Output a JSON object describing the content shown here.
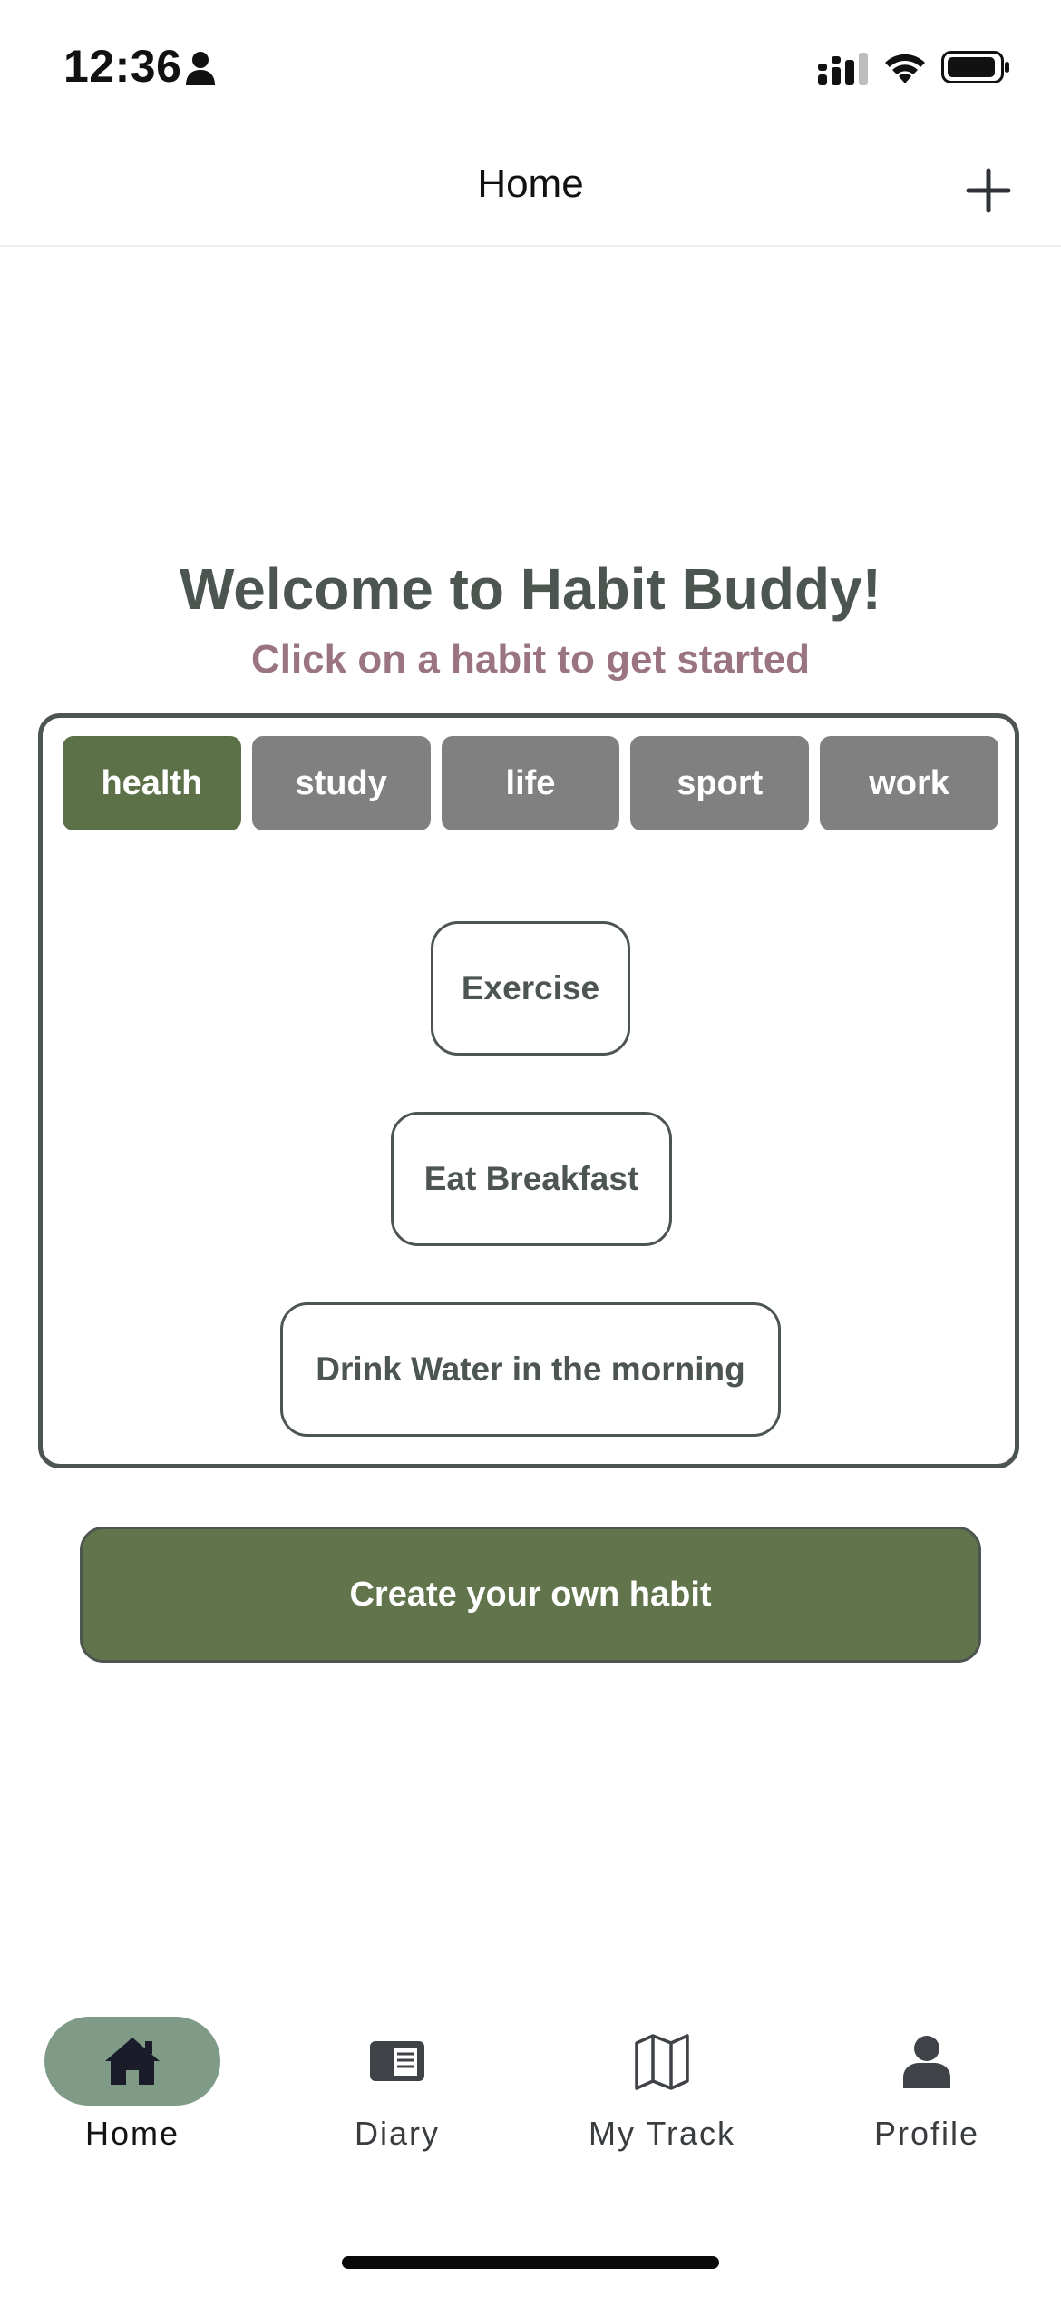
{
  "status_bar": {
    "time": "12:36"
  },
  "nav": {
    "title": "Home",
    "add_icon": "plus-icon"
  },
  "welcome": {
    "title": "Welcome to Habit Buddy!",
    "subtitle": "Click on a habit to get started"
  },
  "categories": {
    "selected": "health",
    "tabs": [
      {
        "label": "health"
      },
      {
        "label": "study"
      },
      {
        "label": "life"
      },
      {
        "label": "sport"
      },
      {
        "label": "work"
      }
    ]
  },
  "habits": [
    {
      "label": "Exercise"
    },
    {
      "label": "Eat Breakfast"
    },
    {
      "label": "Drink Water in the morning"
    }
  ],
  "create_button": {
    "label": "Create your own habit"
  },
  "tab_bar": {
    "selected": "Home",
    "items": [
      {
        "label": "Home",
        "icon": "home-icon"
      },
      {
        "label": "Diary",
        "icon": "newspaper-icon"
      },
      {
        "label": "My Track",
        "icon": "map-icon"
      },
      {
        "label": "Profile",
        "icon": "user-icon"
      }
    ]
  },
  "colors": {
    "accent_green": "#5d7149",
    "button_green": "#61744b",
    "tab_active_pill": "#7f9a87",
    "inactive_tab": "#808080",
    "subtitle_mauve": "#9a7480",
    "title_gray": "#4c554f"
  }
}
